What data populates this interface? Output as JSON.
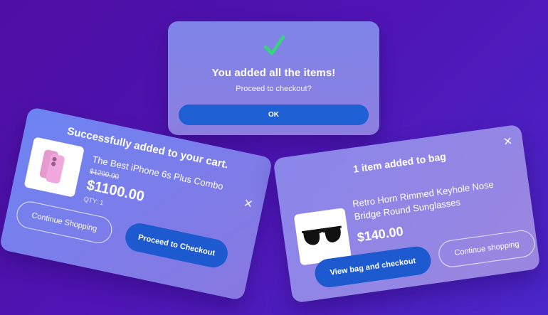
{
  "colors": {
    "accent_button": "#1e5fd4",
    "check_green": "#37d67a"
  },
  "confirmation": {
    "icon": "check-icon",
    "title": "You added all the items!",
    "subtitle": "Proceed to checkout?",
    "ok_label": "OK"
  },
  "cart_card": {
    "title": "Successfully added to your cart.",
    "close_icon": "close-icon",
    "product": {
      "image_icon": "phone-icon",
      "name": "The Best iPhone 6s Plus Combo",
      "old_price": "$1200.00",
      "price": "$1100.00",
      "qty": "QTY: 1"
    },
    "continue_label": "Continue Shopping",
    "checkout_label": "Proceed to Checkout"
  },
  "bag_card": {
    "title": "1 item added to bag",
    "close_icon": "close-icon",
    "product": {
      "image_icon": "sunglasses-icon",
      "name": "Retro Horn Rimmed Keyhole Nose Bridge Round Sunglasses",
      "price": "$140.00"
    },
    "checkout_label": "View bag and checkout",
    "continue_label": "Continue shopping"
  }
}
